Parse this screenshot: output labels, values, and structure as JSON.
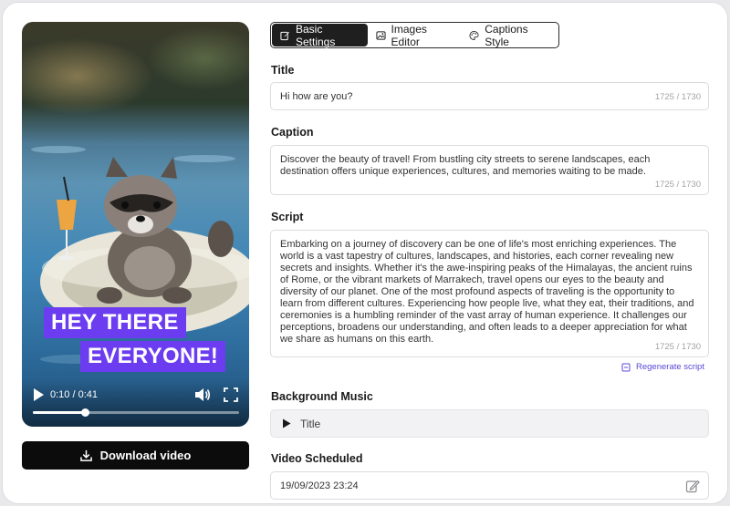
{
  "video": {
    "overlay": [
      "HEY THERE",
      "EVERYONE!"
    ],
    "time": "0:10 / 0:41",
    "progress": 0.25,
    "download_label": "Download video"
  },
  "tabs": [
    {
      "label": "Basic Settings",
      "icon": "edit-icon",
      "active": true
    },
    {
      "label": "Images Editor",
      "icon": "image-icon",
      "active": false
    },
    {
      "label": "Captions Style",
      "icon": "palette-icon",
      "active": false
    }
  ],
  "form": {
    "title": {
      "label": "Title",
      "value": "Hi how are you?",
      "count": "1725 / 1730"
    },
    "caption": {
      "label": "Caption",
      "value": "Discover the beauty of travel! From bustling city streets to serene landscapes, each destination offers unique experiences, cultures, and memories waiting to be made.",
      "count": "1725 / 1730"
    },
    "script": {
      "label": "Script",
      "value": "Embarking on a journey of discovery can be one of life's most enriching experiences. The world is a vast tapestry of cultures, landscapes, and histories, each corner revealing new secrets and insights. Whether it's the awe-inspiring peaks of the Himalayas, the ancient ruins of Rome, or the vibrant markets of Marrakech, travel opens our eyes to the beauty and diversity of our planet. One of the most profound aspects of traveling is the opportunity to learn from different cultures. Experiencing how people live, what they eat, their traditions, and ceremonies is a humbling reminder of the vast array of human experience. It challenges our perceptions, broadens our understanding, and often leads to a deeper appreciation for what we share as humans on this earth.",
      "count": "1725 / 1730",
      "regenerate_label": "Regenerate script"
    },
    "music": {
      "label": "Background Music",
      "value": "Title"
    },
    "schedule": {
      "label": "Video Scheduled",
      "value": "19/09/2023 23:24"
    }
  },
  "colors": {
    "accent": "#6c3cf0",
    "link": "#5a48d6",
    "dark": "#0c0c0c"
  }
}
